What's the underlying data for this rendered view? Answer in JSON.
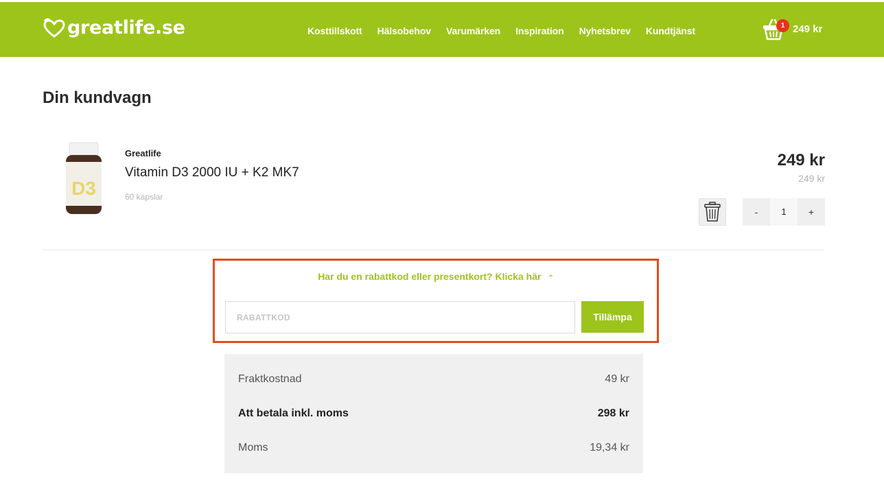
{
  "header": {
    "logo_text": "greatlife.se",
    "nav": [
      "Kosttillskott",
      "Hälsobehov",
      "Varumärken",
      "Inspiration",
      "Nyhetsbrev",
      "Kundtjänst"
    ],
    "cart_count": "1",
    "cart_total": "249 kr"
  },
  "page": {
    "title": "Din kundvagn"
  },
  "item": {
    "brand": "Greatlife",
    "name": "Vitamin D3 2000 IU + K2 MK7",
    "variant": "60 kapslar",
    "price": "249 kr",
    "original_price": "249 kr",
    "quantity": "1",
    "decrement_label": "-",
    "increment_label": "+",
    "image_label": "D3"
  },
  "discount": {
    "link_text": "Har du en rabattkod eller presentkort? Klicka här",
    "placeholder": "RABATTKOD",
    "apply_label": "Tillämpa"
  },
  "summary": {
    "shipping_label": "Fraktkostnad",
    "shipping_value": "49 kr",
    "total_label": "Att betala inkl. moms",
    "total_value": "298 kr",
    "vat_label": "Moms",
    "vat_value": "19,34 kr"
  },
  "colors": {
    "brand_green": "#9dc41b",
    "highlight_border": "#e84a1c",
    "badge_red": "#e8321c"
  }
}
